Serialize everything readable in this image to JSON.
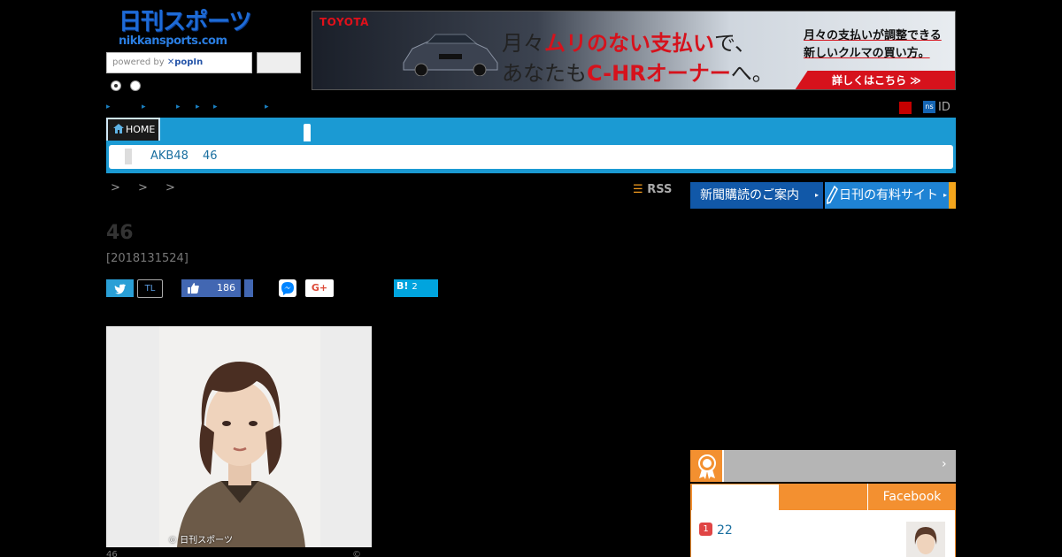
{
  "header": {
    "logo_main": "日刊スポーツ",
    "logo_sub": "nikkansports.com",
    "search_placeholder_prefix": "powered by ",
    "search_placeholder_brand": "✕popIn"
  },
  "ad": {
    "brand": "TOYOTA",
    "line1_a": "月々",
    "line1_red": "ムリのない支払い",
    "line1_b": "で、",
    "line2_a": "あなたも",
    "line2_red": "C-HRオーナー",
    "line2_b": "へ。",
    "right1": "月々の支払いが調整できる",
    "right2": "新しいクルマの買い方。",
    "cta": "詳しくはこちら ≫"
  },
  "topbar": {
    "links": [
      "▸",
      "▸",
      "▸",
      "▸",
      "▸",
      "▸"
    ],
    "ns_badge": "ns",
    "id_label": "ID"
  },
  "nav": {
    "home_label": "HOME",
    "subnav_items": [
      "AKB48",
      "46"
    ]
  },
  "breadcrumb": "> > >",
  "toolbar": {
    "rss_icon": "☰",
    "rss_label": "RSS",
    "subscribe_label": "新聞購読のご案内",
    "paid_label": "日刊の有料サイト",
    "arrow": "▸"
  },
  "article": {
    "title": "46",
    "date": "[2018131524]",
    "share": {
      "tl_label": "TL",
      "like_count": "186",
      "gplus_label": "G+",
      "hatena_label": "B!",
      "hatena_count": "2"
    },
    "photo_credit": "© 日刊スポーツ",
    "photo_caption_left": "46",
    "photo_caption_right": "©"
  },
  "ranking": {
    "tab_facebook": "Facebook",
    "arrow": "›",
    "items": [
      {
        "rank": "1",
        "text": "22"
      }
    ]
  },
  "colors": {
    "nav_blue": "#1b9ad3",
    "accent_orange": "#f39030",
    "subscribe_blue": "#1158a8",
    "paid_blue": "#1f83d4"
  }
}
